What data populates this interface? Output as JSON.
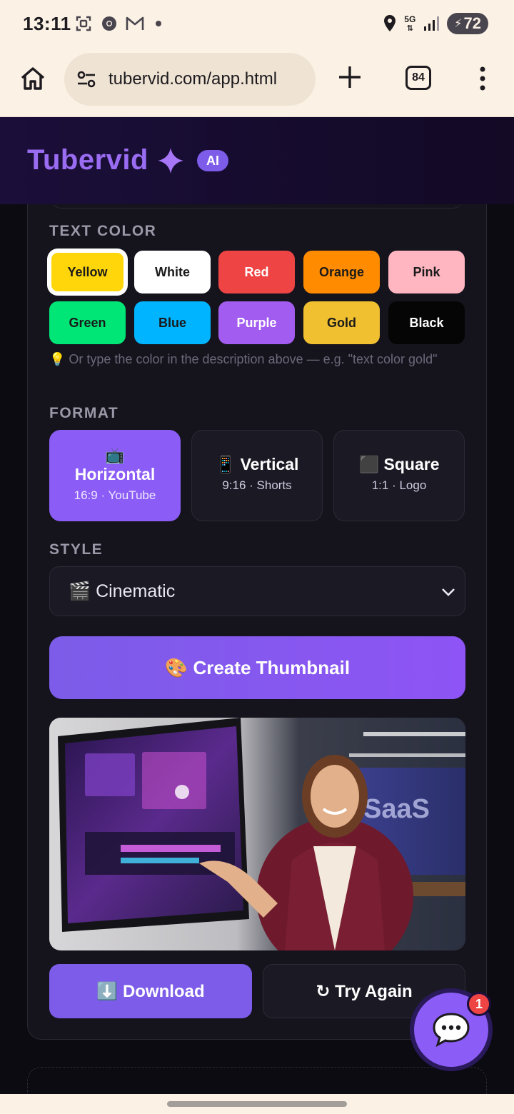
{
  "status_bar": {
    "time": "13:11",
    "network": "5G",
    "battery": "72",
    "icons": [
      "screenshot-icon",
      "chrome-icon",
      "gmail-icon",
      "location-icon",
      "signal-icon"
    ]
  },
  "browser": {
    "url": "tubervid.com/app.html",
    "tab_count": "84"
  },
  "app": {
    "brand": "Tubervid",
    "badge": "AI",
    "accent": "#8b5cf6"
  },
  "text_color": {
    "label": "TEXT COLOR",
    "options": [
      {
        "label": "Yellow",
        "bg": "#ffd60a",
        "fg": "#1a1a1a",
        "selected": true
      },
      {
        "label": "White",
        "bg": "#ffffff",
        "fg": "#1a1a1a"
      },
      {
        "label": "Red",
        "bg": "#ef4444",
        "fg": "#ffffff"
      },
      {
        "label": "Orange",
        "bg": "#ff8c00",
        "fg": "#1a1a1a"
      },
      {
        "label": "Pink",
        "bg": "#ffb6c1",
        "fg": "#1a1a1a"
      },
      {
        "label": "Green",
        "bg": "#00e676",
        "fg": "#1a1a1a"
      },
      {
        "label": "Blue",
        "bg": "#00b4ff",
        "fg": "#1a1a1a"
      },
      {
        "label": "Purple",
        "bg": "#a35cf0",
        "fg": "#ffffff"
      },
      {
        "label": "Gold",
        "bg": "#f0c030",
        "fg": "#1a1a1a"
      },
      {
        "label": "Black",
        "bg": "#050505",
        "fg": "#ffffff"
      }
    ],
    "hint": "💡 Or type the color in the description above — e.g. \"text color gold\""
  },
  "format": {
    "label": "FORMAT",
    "options": [
      {
        "icon": "📺",
        "title": "Horizontal",
        "sub": "16:9 · YouTube",
        "active": true
      },
      {
        "icon": "📱",
        "title": "Vertical",
        "sub": "9:16 · Shorts"
      },
      {
        "icon": "⬛",
        "title": "Square",
        "sub": "1:1 · Logo"
      }
    ]
  },
  "style": {
    "label": "STYLE",
    "selected": "🎬 Cinematic"
  },
  "create_button": "🎨 Create Thumbnail",
  "actions": {
    "download": "⬇️ Download",
    "try_again": "↻ Try Again"
  },
  "chat": {
    "badge": "1"
  }
}
